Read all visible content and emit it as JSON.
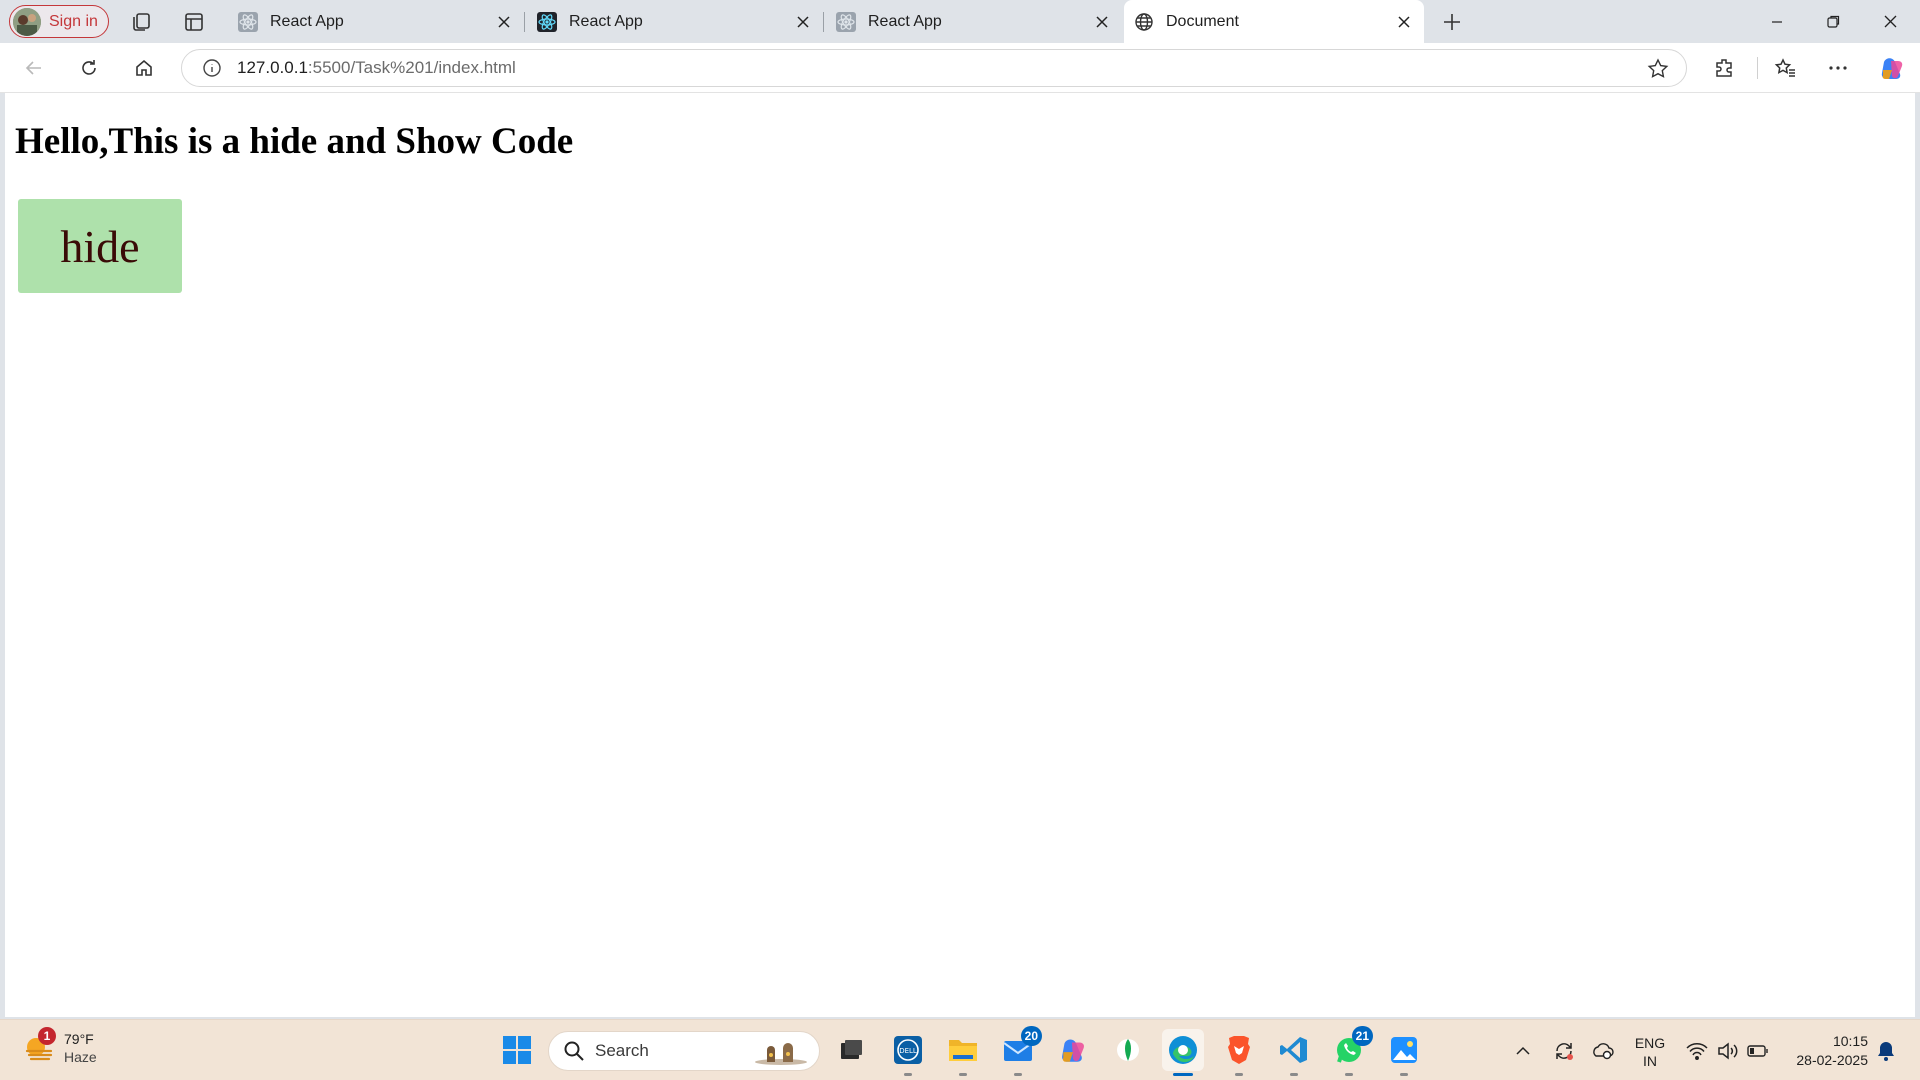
{
  "browser": {
    "profile_label": "Sign in",
    "tabs": [
      {
        "title": "React App",
        "active": false
      },
      {
        "title": "React App",
        "active": false
      },
      {
        "title": "React App",
        "active": false
      },
      {
        "title": "Document",
        "active": true
      }
    ],
    "url_host": "127.0.0.1",
    "url_rest": ":5500/Task%201/index.html"
  },
  "page": {
    "heading": "Hello,This is a hide and Show Code",
    "button_label": "hide",
    "button_color": "#aee1ab",
    "button_text_color": "#3a0b07"
  },
  "taskbar": {
    "weather_temp": "79°F",
    "weather_condition": "Haze",
    "weather_badge": "1",
    "search_placeholder": "Search",
    "mail_badge": "20",
    "whatsapp_badge": "21",
    "language_line1": "ENG",
    "language_line2": "IN",
    "time": "10:15",
    "date": "28-02-2025"
  },
  "colors": {
    "tabstrip": "#dfe3e8",
    "accent": "#0067c0",
    "taskbar": "#f2e4d6"
  }
}
